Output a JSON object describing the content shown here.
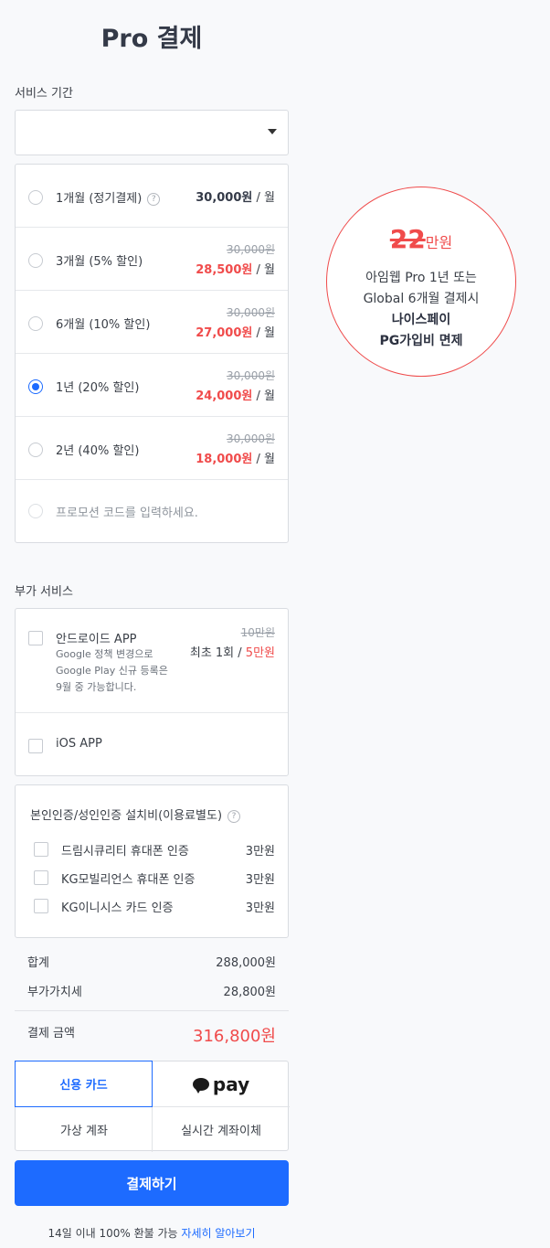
{
  "page_title": "Pro 결제",
  "service_period": {
    "label": "서비스 기간",
    "select_value": "",
    "plans": [
      {
        "name": "1개월 (정기결제)",
        "has_help": true,
        "old_price": "",
        "price": "30,000원",
        "unit": "/ 월",
        "selected": false
      },
      {
        "name": "3개월 (5% 할인)",
        "old_price": "30,000원",
        "price": "28,500원",
        "unit": "/ 월",
        "selected": false
      },
      {
        "name": "6개월 (10% 할인)",
        "old_price": "30,000원",
        "price": "27,000원",
        "unit": "/ 월",
        "selected": false
      },
      {
        "name": "1년 (20% 할인)",
        "old_price": "30,000원",
        "price": "24,000원",
        "unit": "/ 월",
        "selected": true
      },
      {
        "name": "2년 (40% 할인)",
        "old_price": "30,000원",
        "price": "18,000원",
        "unit": "/ 월",
        "selected": false
      }
    ],
    "promo_placeholder": "프로모션 코드를 입력하세요."
  },
  "promo_badge": {
    "amount": "22",
    "suffix": "만원",
    "line1": "아임웹 Pro 1년 또는",
    "line2": "Global 6개월 결제시",
    "line3": "나이스페이",
    "line4": "PG가입비 면제"
  },
  "addons": {
    "label": "부가 서비스",
    "android": {
      "name": "안드로이드 APP",
      "desc1": "Google 정책 변경으로",
      "desc2": "Google Play 신규 등록은",
      "desc3": "9월 중 가능합니다.",
      "old_price": "10만원",
      "prefix": "최초 1회 /",
      "price": "5만원"
    },
    "ios": {
      "name": "iOS APP"
    }
  },
  "certification": {
    "title": "본인인증/성인인증 설치비(이용료별도)",
    "items": [
      {
        "name": "드림시큐리티 휴대폰 인증",
        "cost": "3만원"
      },
      {
        "name": "KG모빌리언스 휴대폰 인증",
        "cost": "3만원"
      },
      {
        "name": "KG이니시스 카드 인증",
        "cost": "3만원"
      }
    ]
  },
  "summary": {
    "subtotal_label": "합계",
    "subtotal": "288,000원",
    "vat_label": "부가가치세",
    "vat": "28,800원",
    "total_label": "결제 금액",
    "total": "316,800원"
  },
  "payment_methods": {
    "card": "신용 카드",
    "kakao": "pay",
    "virtual": "가상 계좌",
    "transfer": "실시간 계좌이체"
  },
  "pay_button": "결제하기",
  "refund": {
    "text": "14일 이내 100% 환불 가능",
    "link": "자세히 알아보기"
  }
}
